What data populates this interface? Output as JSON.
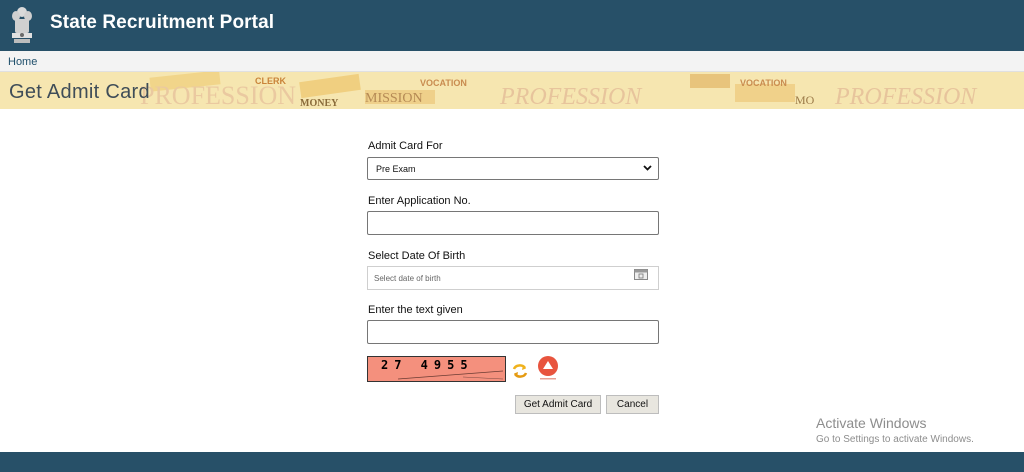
{
  "header": {
    "title": "State Recruitment Portal"
  },
  "breadcrumb": {
    "home": "Home"
  },
  "banner": {
    "heading": "Get Admit Card",
    "words": [
      "PROFESSION",
      "CLERK",
      "MONEY",
      "MISSION",
      "VOCATION",
      "PROFESSION",
      "VOCATION",
      "MO",
      "PROFESSION"
    ]
  },
  "form": {
    "admit_card_for_label": "Admit Card For",
    "admit_card_for_value": "Pre Exam",
    "application_no_label": "Enter Application No.",
    "application_no_value": "",
    "dob_label": "Select Date Of Birth",
    "dob_placeholder": "Select date of birth",
    "captcha_label": "Enter the text given",
    "captcha_value": "",
    "captcha_text": "27 4955",
    "get_admit_card_label": "Get Admit Card",
    "cancel_label": "Cancel"
  },
  "icons": {
    "emblem": "state-emblem-icon",
    "dropdown": "chevron-down-icon",
    "calendar": "calendar-icon",
    "refresh": "refresh-icon",
    "audio": "audio-captcha-icon"
  },
  "colors": {
    "header": "#275068",
    "banner": "#f6e7b4",
    "captcha_bg": "#f4907d"
  },
  "watermark": {
    "title": "Activate Windows",
    "subtitle": "Go to Settings to activate Windows."
  }
}
